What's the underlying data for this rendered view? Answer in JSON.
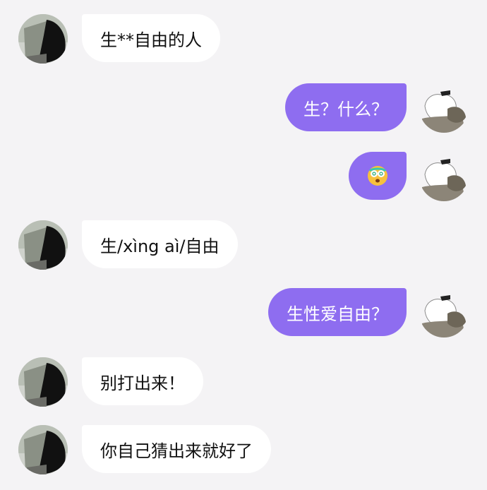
{
  "colors": {
    "background": "#f4f3f5",
    "incoming_bubble": "#ffffff",
    "outgoing_bubble": "#8e6df0"
  },
  "messages": [
    {
      "side": "in",
      "text": "生**自由的人"
    },
    {
      "side": "out",
      "text": "生？什么？"
    },
    {
      "side": "out",
      "emoji": "face-with-spiral-eyes"
    },
    {
      "side": "in",
      "text": "生/xìng aì/自由"
    },
    {
      "side": "out",
      "text": "生性爱自由？"
    },
    {
      "side": "in",
      "text": "别打出来！"
    },
    {
      "side": "in",
      "text": "你自己猜出来就好了"
    }
  ]
}
